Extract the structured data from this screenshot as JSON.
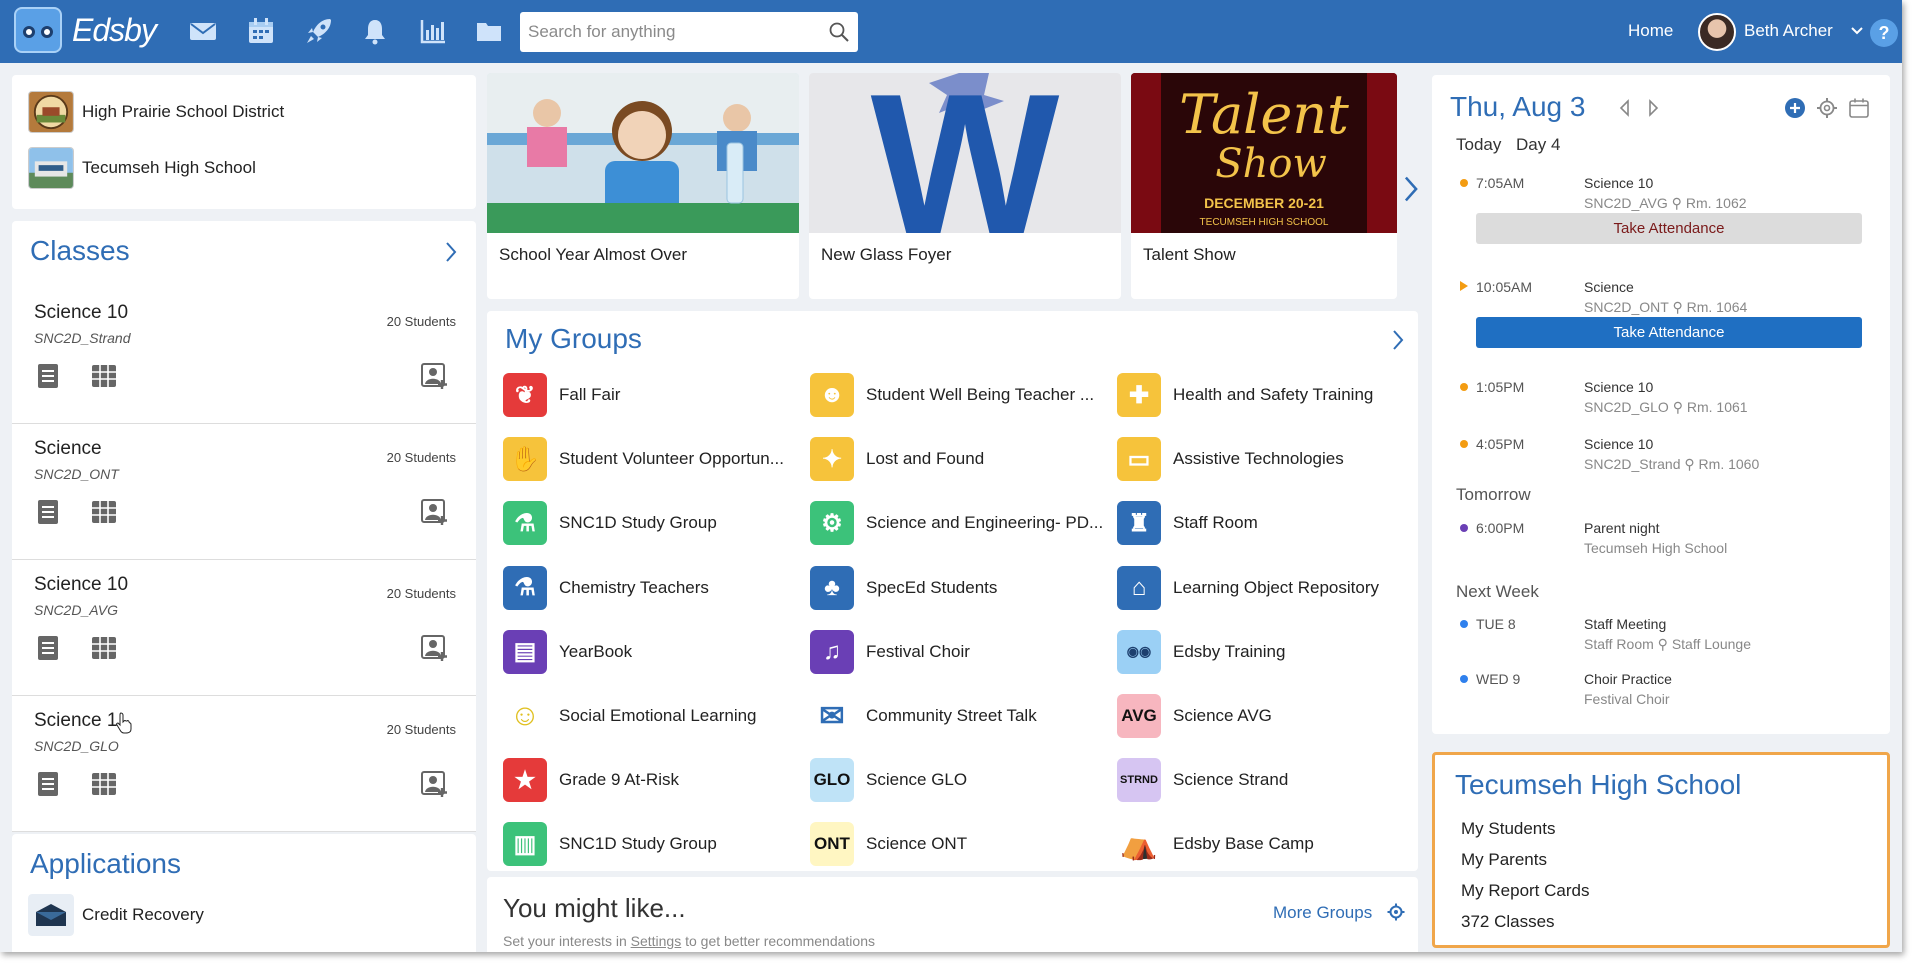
{
  "topbar": {
    "app_name": "Edsby",
    "icons": [
      "mail-icon",
      "calendar-icon",
      "rocket-icon",
      "bell-icon",
      "chart-icon",
      "folder-icon"
    ],
    "search_placeholder": "Search for anything",
    "home_label": "Home",
    "user_name": "Beth Archer",
    "help_label": "?"
  },
  "schools": {
    "district": "High Prairie School District",
    "school": "Tecumseh High School"
  },
  "classes": {
    "title": "Classes",
    "items": [
      {
        "name": "Science 10",
        "code": "SNC2D_Strand",
        "count": "20 Students"
      },
      {
        "name": "Science",
        "code": "SNC2D_ONT",
        "count": "20 Students"
      },
      {
        "name": "Science 10",
        "code": "SNC2D_AVG",
        "count": "20 Students"
      },
      {
        "name": "Science 1",
        "code": "SNC2D_GLO",
        "count": "20 Students"
      }
    ]
  },
  "applications": {
    "title": "Applications",
    "items": [
      {
        "label": "Credit Recovery"
      }
    ]
  },
  "news": {
    "items": [
      {
        "caption": "School Year Almost Over"
      },
      {
        "caption": "New Glass Foyer"
      },
      {
        "caption": "Talent Show",
        "art_title_1": "Talent",
        "art_title_2": "Show",
        "art_date": "DECEMBER 20-21",
        "art_school": "TECUMSEH HIGH SCHOOL"
      }
    ],
    "foyer_letter": "W"
  },
  "groups": {
    "title": "My Groups",
    "items": [
      {
        "label": "Fall Fair",
        "icon": "leaf-icon",
        "color": "#e53a3a",
        "text": ""
      },
      {
        "label": "Student Well Being Teacher ...",
        "icon": "head-icon",
        "color": "#f6c33b",
        "text": ""
      },
      {
        "label": "Health and Safety Training",
        "icon": "first-aid-icon",
        "color": "#f6c33b",
        "text": ""
      },
      {
        "label": "Student Volunteer Opportun...",
        "icon": "hands-icon",
        "color": "#f6c33b",
        "text": ""
      },
      {
        "label": "Lost and Found",
        "icon": "magic-icon",
        "color": "#f6c33b",
        "text": ""
      },
      {
        "label": "Assistive Technologies",
        "icon": "computer-icon",
        "color": "#f6c33b",
        "text": ""
      },
      {
        "label": "SNC1D Study Group",
        "icon": "microscope-icon",
        "color": "#3cc27a",
        "text": ""
      },
      {
        "label": "Science and Engineering- PD...",
        "icon": "gears-icon",
        "color": "#3cc27a",
        "text": ""
      },
      {
        "label": "Staff Room",
        "icon": "chair-icon",
        "color": "#2f6db5",
        "text": ""
      },
      {
        "label": "Chemistry Teachers",
        "icon": "flask-icon",
        "color": "#2f6db5",
        "text": ""
      },
      {
        "label": "SpecEd Students",
        "icon": "tree-icon",
        "color": "#2f6db5",
        "text": ""
      },
      {
        "label": "Learning Object Repository",
        "icon": "building-icon",
        "color": "#2f6db5",
        "text": ""
      },
      {
        "label": "YearBook",
        "icon": "book-icon",
        "color": "#6a3fb5",
        "text": ""
      },
      {
        "label": "Festival Choir",
        "icon": "choir-icon",
        "color": "#6a3fb5",
        "text": ""
      },
      {
        "label": "Edsby Training",
        "icon": "edsby-icon",
        "color": "#9bd0f5",
        "text": ""
      },
      {
        "label": "Social Emotional Learning",
        "icon": "smiley-icon",
        "color": "#ffffff",
        "text": ""
      },
      {
        "label": "Community Street Talk",
        "icon": "street-talk-icon",
        "color": "#ffffff",
        "text": ""
      },
      {
        "label": "Science AVG",
        "icon": "avg-icon",
        "color": "#f7b6bf",
        "text": "AVG"
      },
      {
        "label": "Grade 9 At-Risk",
        "icon": "star-icon",
        "color": "#e53a3a",
        "text": ""
      },
      {
        "label": "Science GLO",
        "icon": "glo-icon",
        "color": "#bfe3f7",
        "text": "GLO"
      },
      {
        "label": "Science Strand",
        "icon": "strnd-icon",
        "color": "#d6c5f2",
        "text": "STRND"
      },
      {
        "label": "SNC1D Study Group",
        "icon": "open-book-icon",
        "color": "#3cc27a",
        "text": ""
      },
      {
        "label": "Science ONT",
        "icon": "ont-icon",
        "color": "#fff6c2",
        "text": "ONT"
      },
      {
        "label": "Edsby Base Camp",
        "icon": "camp-icon",
        "color": "#ffffff",
        "text": ""
      }
    ]
  },
  "recommend": {
    "title": "You might like...",
    "more_groups": "More Groups",
    "hint_before": "Set your interests in ",
    "hint_link": "Settings",
    "hint_after": " to get better recommendations"
  },
  "calendar": {
    "date": "Thu, Aug 3",
    "today": "Today",
    "day": "Day 4",
    "today_events": [
      {
        "time": "7:05AM",
        "title": "Science 10",
        "sub": "SNC2D_AVG",
        "room": "Rm. 1062",
        "dot": "#f39c12",
        "button": "Take Attendance",
        "button_style": "gray"
      },
      {
        "time": "10:05AM",
        "title": "Science",
        "sub": "SNC2D_ONT",
        "room": "Rm. 1064",
        "dot": "#f39c12",
        "button": "Take Attendance",
        "button_style": "blue"
      },
      {
        "time": "1:05PM",
        "title": "Science 10",
        "sub": "SNC2D_GLO",
        "room": "Rm. 1061",
        "dot": "#f39c12"
      },
      {
        "time": "4:05PM",
        "title": "Science 10",
        "sub": "SNC2D_Strand",
        "room": "Rm. 1060",
        "dot": "#f39c12"
      }
    ],
    "tomorrow_label": "Tomorrow",
    "tomorrow_event": {
      "time": "6:00PM",
      "title": "Parent night",
      "sub": "Tecumseh High School",
      "dot": "#6a3fb5"
    },
    "next_week_label": "Next Week",
    "next_week_events": [
      {
        "time": "TUE 8",
        "title": "Staff Meeting",
        "sub": "Staff Room",
        "room": "Staff Lounge",
        "dot": "#2f80ed"
      },
      {
        "time": "WED 9",
        "title": "Choir Practice",
        "sub": "Festival Choir",
        "dot": "#2f80ed"
      }
    ]
  },
  "school_links": {
    "title": "Tecumseh High School",
    "items": [
      "My Students",
      "My Parents",
      "My Report Cards",
      "372 Classes"
    ]
  },
  "colors": {
    "brand": "#2f6db5",
    "highlight": "#f0a64a"
  }
}
